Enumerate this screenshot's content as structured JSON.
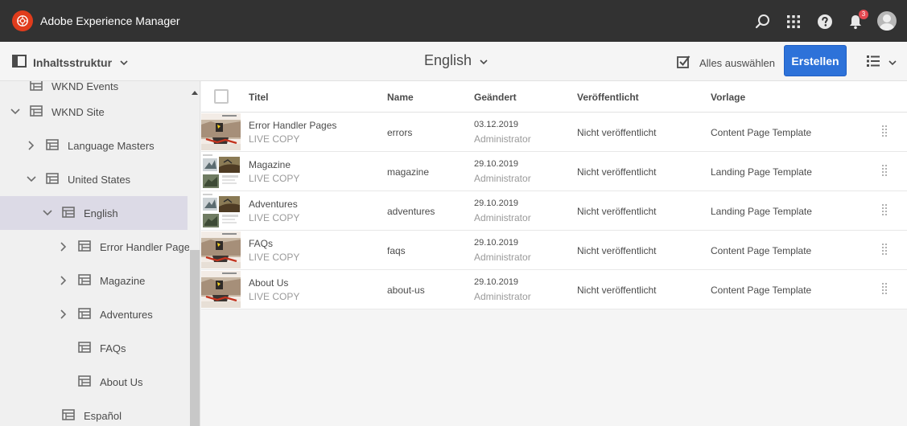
{
  "header": {
    "app_title": "Adobe Experience Manager",
    "notifications_count": "3",
    "icons": [
      "search-icon",
      "apps-grid-icon",
      "help-icon",
      "bell-icon",
      "avatar"
    ],
    "colors": {
      "bar": "#323232",
      "logo": "#e03c1c",
      "badge": "#e34850"
    }
  },
  "actionbar": {
    "rail_label": "Inhaltsstruktur",
    "title": "English",
    "select_all_label": "Alles auswählen",
    "create_label": "Erstellen",
    "colors": {
      "primary": "#2d72d9"
    }
  },
  "rail": {
    "items": [
      {
        "label": "WKND Events",
        "expander": "none"
      },
      {
        "label": "WKND Site",
        "expander": "expanded"
      },
      {
        "label": "Language Masters",
        "expander": "collapsed"
      },
      {
        "label": "United States",
        "expander": "expanded"
      },
      {
        "label": "English",
        "expander": "expanded",
        "selected": true
      },
      {
        "label": "Error Handler Pages",
        "expander": "collapsed"
      },
      {
        "label": "Magazine",
        "expander": "collapsed"
      },
      {
        "label": "Adventures",
        "expander": "collapsed"
      },
      {
        "label": "FAQs",
        "expander": "none"
      },
      {
        "label": "About Us",
        "expander": "none"
      },
      {
        "label": "Español",
        "expander": "none"
      }
    ]
  },
  "table": {
    "columns": [
      "Titel",
      "Name",
      "Geändert",
      "Veröffentlicht",
      "Vorlage"
    ],
    "rows": [
      {
        "title": "Error Handler Pages",
        "sub": "LIVE COPY",
        "name": "errors",
        "date": "03.12.2019",
        "user": "Administrator",
        "published": "Nicht veröffentlicht",
        "template": "Content Page Template",
        "thumb": "skater"
      },
      {
        "title": "Magazine",
        "sub": "LIVE COPY",
        "name": "magazine",
        "date": "29.10.2019",
        "user": "Administrator",
        "published": "Nicht veröffentlicht",
        "template": "Landing Page Template",
        "thumb": "landing"
      },
      {
        "title": "Adventures",
        "sub": "LIVE COPY",
        "name": "adventures",
        "date": "29.10.2019",
        "user": "Administrator",
        "published": "Nicht veröffentlicht",
        "template": "Landing Page Template",
        "thumb": "landing"
      },
      {
        "title": "FAQs",
        "sub": "LIVE COPY",
        "name": "faqs",
        "date": "29.10.2019",
        "user": "Administrator",
        "published": "Nicht veröffentlicht",
        "template": "Content Page Template",
        "thumb": "skater"
      },
      {
        "title": "About Us",
        "sub": "LIVE COPY",
        "name": "about-us",
        "date": "29.10.2019",
        "user": "Administrator",
        "published": "Nicht veröffentlicht",
        "template": "Content Page Template",
        "thumb": "skater"
      }
    ]
  }
}
